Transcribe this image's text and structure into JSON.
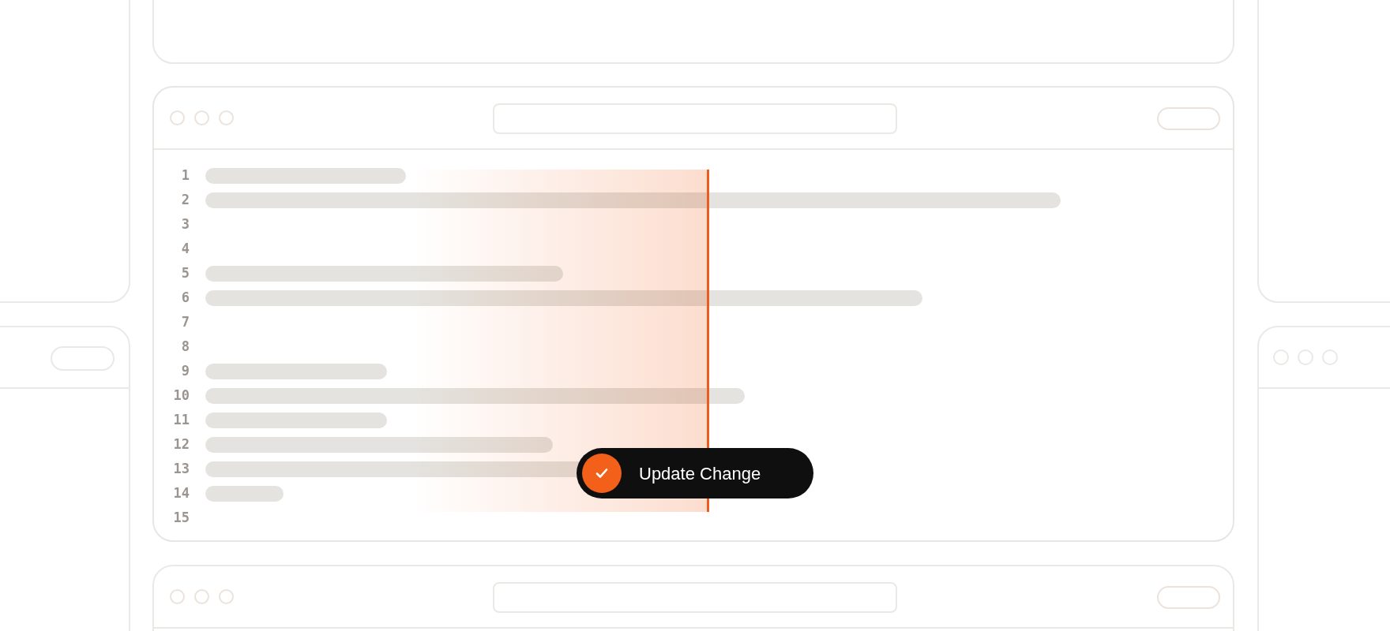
{
  "editor": {
    "lines": [
      {
        "number": "1",
        "kind": "text"
      },
      {
        "number": "2",
        "kind": "text"
      },
      {
        "number": "3",
        "kind": "blank"
      },
      {
        "number": "4",
        "kind": "blank"
      },
      {
        "number": "5",
        "kind": "text"
      },
      {
        "number": "6",
        "kind": "text"
      },
      {
        "number": "7",
        "kind": "blank"
      },
      {
        "number": "8",
        "kind": "blank"
      },
      {
        "number": "9",
        "kind": "text"
      },
      {
        "number": "10",
        "kind": "text"
      },
      {
        "number": "11",
        "kind": "text"
      },
      {
        "number": "12",
        "kind": "text"
      },
      {
        "number": "13",
        "kind": "text"
      },
      {
        "number": "14",
        "kind": "text"
      },
      {
        "number": "15",
        "kind": "blank"
      }
    ]
  },
  "toast": {
    "label": "Update Change"
  }
}
